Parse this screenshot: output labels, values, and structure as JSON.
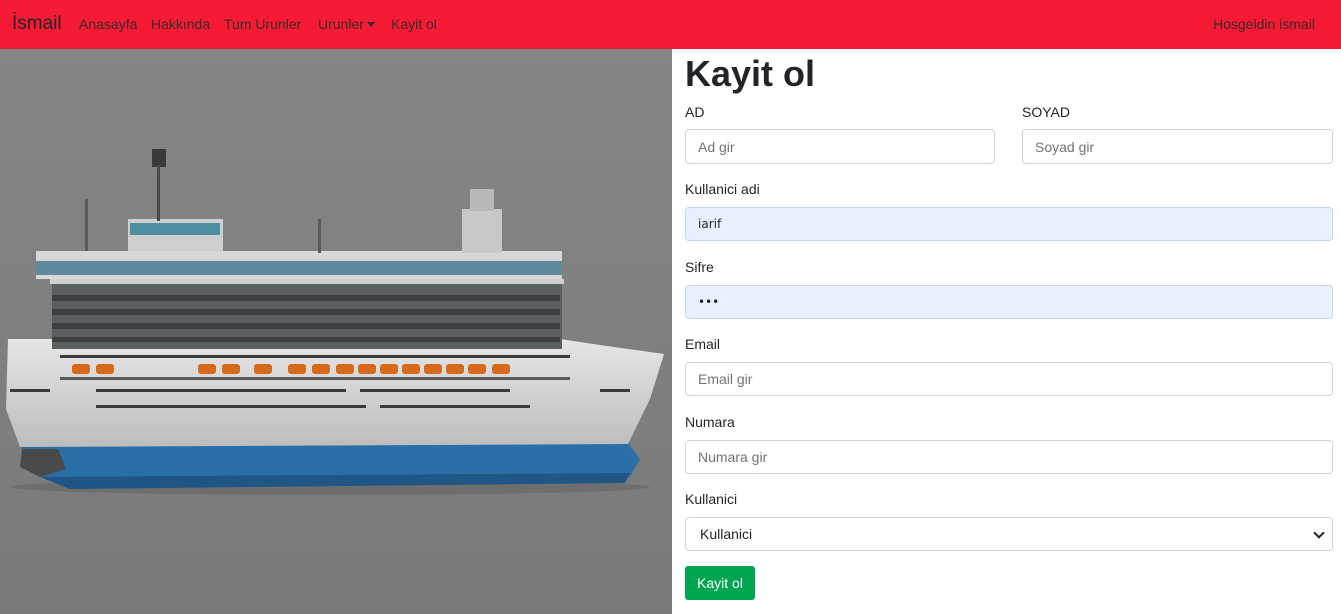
{
  "nav": {
    "brand": "İsmail",
    "links": [
      "Anasayfa",
      "Hakkında",
      "Tum Urunler",
      "Urunler",
      "Kayit ol"
    ],
    "greeting": "Hosgeldin ismail"
  },
  "colors": {
    "navbar": "#f61a35",
    "submit": "#00a650",
    "autofill": "#e8f0fe"
  },
  "hero": {
    "image": "cruise-ship"
  },
  "form": {
    "title": "Kayit ol",
    "ad_label": "AD",
    "ad_placeholder": "Ad gir",
    "soyad_label": "SOYAD",
    "soyad_placeholder": "Soyad gir",
    "kullanici_adi_label": "Kullanici adi",
    "kullanici_adi_value": "iarif",
    "sifre_label": "Sifre",
    "sifre_value": "•••",
    "email_label": "Email",
    "email_placeholder": "Email gir",
    "numara_label": "Numara",
    "numara_placeholder": "Numara gir",
    "kullanici_label": "Kullanici",
    "kullanici_selected": "Kullanici",
    "submit_label": "Kayit ol"
  }
}
